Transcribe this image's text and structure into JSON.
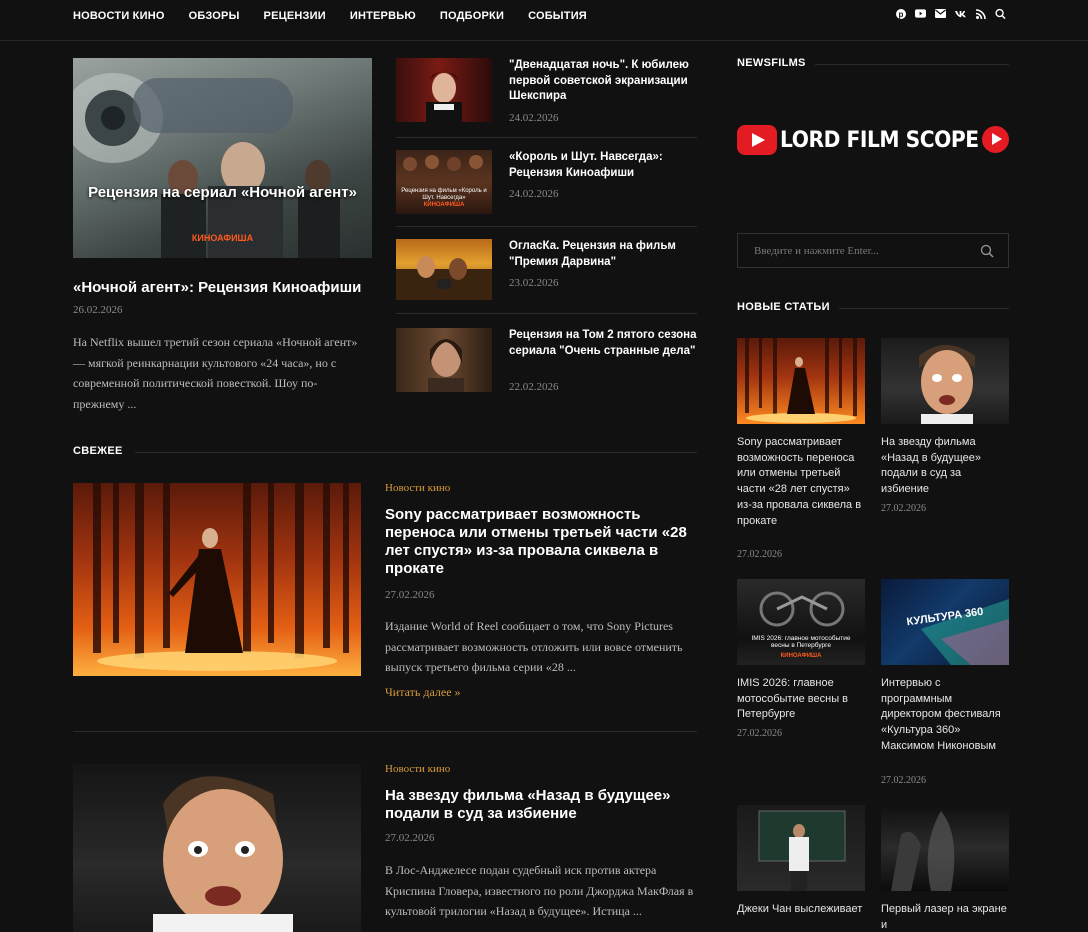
{
  "nav": {
    "items": [
      "НОВОСТИ КИНО",
      "ОБЗОРЫ",
      "РЕЦЕНЗИИ",
      "ИНТЕРВЬЮ",
      "ПОДБОРКИ",
      "СОБЫТИЯ"
    ],
    "icons": [
      "pinterest-icon",
      "youtube-icon",
      "email-icon",
      "vk-icon",
      "rss-icon",
      "search-icon"
    ]
  },
  "featured": {
    "image_caption": "Рецензия на сериал «Ночной агент»",
    "image_brand": "КИНОАФИША",
    "title": "«Ночной агент»: Рецензия Киноафиши",
    "date": "26.02.2026",
    "excerpt": "На Netflix вышел третий сезон сериала «Ночной агент» — мягкой реинкарнации культового «24 часа», но с современной политической повесткой. Шоу по-прежнему ..."
  },
  "small_list": [
    {
      "title": "\"Двенадцатая ночь\". К юбилею первой советской экранизации Шекспира",
      "date": "24.02.2026"
    },
    {
      "title": "«Король и Шут. Навсегда»: Рецензия Киноафиши",
      "date": "24.02.2026",
      "thumb_text": "Рецензия на фильм «Король и Шут. Навсегда»",
      "thumb_brand": "КИНОАФИША"
    },
    {
      "title": "ОгласКа. Рецензия на фильм \"Премия Дарвина\"",
      "date": "23.02.2026"
    },
    {
      "title": "Рецензия на Том 2 пятого сезона сериала \"Очень странные дела\"",
      "date": "22.02.2026"
    }
  ],
  "fresh": {
    "heading": "СВЕЖЕЕ",
    "posts": [
      {
        "category": "Новости кино",
        "title": "Sony рассматривает возможность переноса или отмены третьей части «28 лет спустя» из-за провала сиквела в прокате",
        "date": "27.02.2026",
        "excerpt": "Издание World of Reel сообщает о том, что Sony Pictures рассматривает возможность отложить или вовсе отменить выпуск третьего фильма серии «28 ...",
        "more": "Читать далее »"
      },
      {
        "category": "Новости кино",
        "title": "На звезду фильма «Назад в будущее» подали в суд за избиение",
        "date": "27.02.2026",
        "excerpt": "В Лос-Анджелесе подан судебный иск против актера Криспина Гловера, известного по роли Джорджа МакФлая в культовой трилогии «Назад в будущее». Истица ..."
      }
    ]
  },
  "sidebar": {
    "newsfilms_heading": "NEWSFILMS",
    "logo_text": "LORD FILM SCOPE",
    "search_placeholder": "Введите и нажмите Enter...",
    "new_heading": "НОВЫЕ СТАТЬИ",
    "cards": [
      {
        "title": "Sony рассматривает возможность переноса или отмены третьей части «28 лет спустя» из-за провала сиквела в прокате",
        "date": "27.02.2026"
      },
      {
        "title": "На звезду фильма «Назад в будущее» подали в суд за избиение",
        "date": "27.02.2026"
      },
      {
        "title": "IMIS 2026: главное мотособытие весны в Петербурге",
        "date": "27.02.2026",
        "thumb_text": "IMIS 2026: главное мотособытие весны в Петербурге",
        "thumb_brand": "КИНОАФИША"
      },
      {
        "title": "Интервью с программным директором фестиваля «Культура 360» Максимом Никоновым",
        "date": "27.02.2026",
        "thumb_text": "КУЛЬТУРА 360"
      },
      {
        "title": "Джеки Чан выслеживает",
        "date": ""
      },
      {
        "title": "Первый лазер на экране и",
        "date": ""
      }
    ]
  },
  "colors": {
    "background": "#111111",
    "accent": "#d89a3a",
    "brand_red": "#e31b23"
  }
}
